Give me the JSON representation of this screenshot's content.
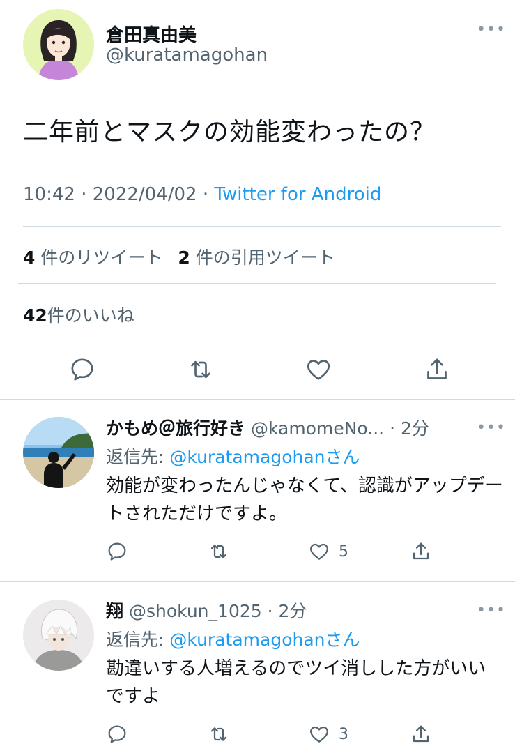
{
  "main_tweet": {
    "display_name": "倉田真由美",
    "handle": "@kuratamagohan",
    "text": "二年前とマスクの効能変わったの？",
    "time": "10:42",
    "separator": "·",
    "date": "2022/04/02",
    "source": "Twitter for Android",
    "retweets_count": "4",
    "retweets_label": "件のリツイート",
    "quotes_count": "2",
    "quotes_label": "件の引用ツイート",
    "likes_count": "42",
    "likes_label": "件のいいね",
    "more_icon": "•••"
  },
  "replies": [
    {
      "display_name": "かもめ＠旅行好き",
      "handle": "@kamomeNo...",
      "time": "· 2分",
      "reply_to_label": "返信先: ",
      "reply_to_mention": "@kuratamagohan",
      "reply_to_suffix": "さん",
      "text": "効能が変わったんじゃなくて、認識がアップデートされただけですよ。",
      "like_count": "5"
    },
    {
      "display_name": "翔",
      "handle": "@shokun_1025",
      "time": "· 2分",
      "reply_to_label": "返信先: ",
      "reply_to_mention": "@kuratamagohan",
      "reply_to_suffix": "さん",
      "text": "勘違いする人増えるのでツイ消しした方がいいですよ",
      "like_count": "3"
    }
  ],
  "icons": {
    "reply": "reply-icon",
    "retweet": "retweet-icon",
    "like": "heart-icon",
    "share": "share-icon",
    "more": "more-icon"
  },
  "colors": {
    "accent": "#1d9bf0",
    "text": "#0f1419",
    "secondary": "#536471",
    "divider": "#cfd9de"
  }
}
